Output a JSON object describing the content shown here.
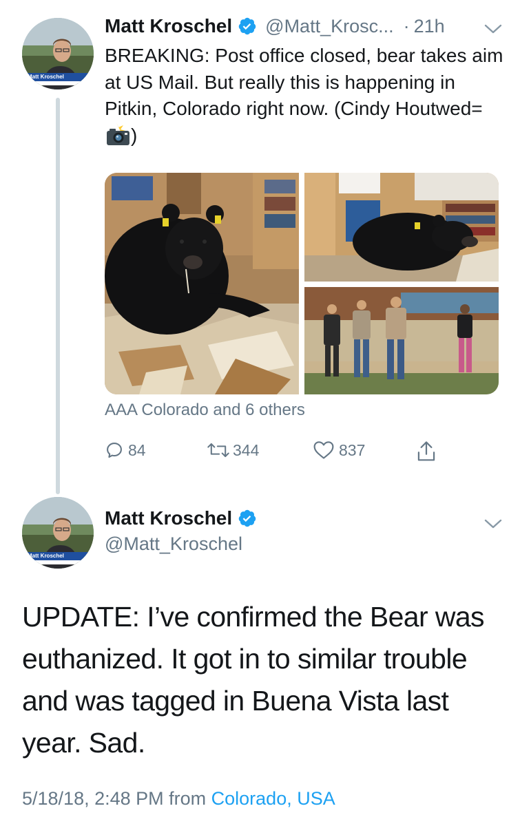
{
  "tweet1": {
    "display_name": "Matt Kroschel",
    "handle": "@Matt_Krosc...",
    "separator": "·",
    "time": "21h",
    "avatar_caption": "Matt Kroschel",
    "text_before_emoji": "BREAKING: Post office closed, bear takes aim at US Mail. But really this is happening in Pitkin, Colorado right now. (Cindy Houtwed=",
    "text_after_emoji": ")",
    "emoji": "camera-with-flash-icon",
    "tagged": "AAA Colorado and 6 others",
    "actions": {
      "reply_count": "84",
      "retweet_count": "344",
      "like_count": "837"
    }
  },
  "tweet2": {
    "display_name": "Matt Kroschel",
    "handle": "@Matt_Kroschel",
    "avatar_caption": "Matt Kroschel",
    "text": "UPDATE: I’ve confirmed the Bear was euthanized. It got in to similar trouble and was tagged in Buena Vista last year. Sad.",
    "meta_prefix": "5/18/18, 2:48 PM from ",
    "location": "Colorado, USA"
  },
  "colors": {
    "verified": "#1da1f2",
    "secondary_text": "#657786",
    "link": "#1da1f2",
    "thread_line": "#cfd9de"
  }
}
